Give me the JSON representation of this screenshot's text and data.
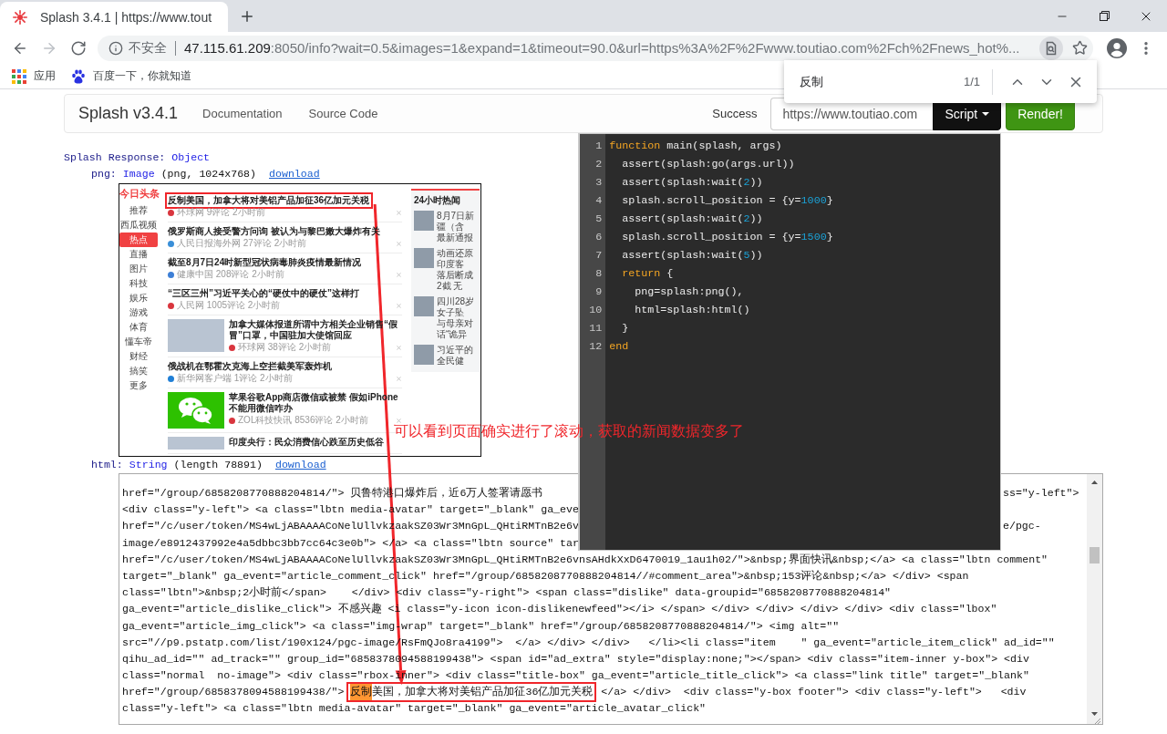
{
  "browser": {
    "tab_title": "Splash 3.4.1 | https://www.tout",
    "nav_buttons": [
      {
        "kind": "back",
        "disabled": false
      },
      {
        "kind": "forward",
        "disabled": true
      },
      {
        "kind": "reload",
        "disabled": false
      }
    ],
    "security_label": "不安全",
    "url_host": "47.115.61.209",
    "url_path": ":8050/info?wait=0.5&images=1&expand=1&timeout=90.0&url=https%3A%2F%2Fwww.toutiao.com%2Fch%2Fnews_hot%...",
    "bookmarks": [
      {
        "kind": "apps",
        "label": "应用"
      },
      {
        "kind": "site",
        "label": "百度一下，你就知道"
      }
    ]
  },
  "find_bar": {
    "query": "反制",
    "count": "1/1"
  },
  "navbar": {
    "brand": "Splash v3.4.1",
    "links": [
      "Documentation",
      "Source Code"
    ],
    "status": "Success",
    "url_field": {
      "value": "https://www.toutiao.com"
    },
    "buttons": [
      {
        "kind": "dropdown",
        "label": "Script",
        "expanded": true
      },
      {
        "kind": "primary",
        "label": "Render!"
      }
    ]
  },
  "script_editor": {
    "lines": [
      {
        "number": "1",
        "tokens": [
          {
            "kind": "keyword",
            "text": "function"
          },
          {
            "kind": "plain",
            "text": " main(splash, args)"
          }
        ]
      },
      {
        "number": "2",
        "tokens": [
          {
            "kind": "plain",
            "text": "  assert(splash:go(args.url))"
          }
        ]
      },
      {
        "number": "3",
        "tokens": [
          {
            "kind": "plain",
            "text": "  assert(splash:wait("
          },
          {
            "kind": "number",
            "text": "2"
          },
          {
            "kind": "plain",
            "text": "))"
          }
        ]
      },
      {
        "number": "4",
        "tokens": [
          {
            "kind": "plain",
            "text": "  splash.scroll_position = {y="
          },
          {
            "kind": "number",
            "text": "1000"
          },
          {
            "kind": "plain",
            "text": "}"
          }
        ]
      },
      {
        "number": "5",
        "tokens": [
          {
            "kind": "plain",
            "text": "  assert(splash:wait("
          },
          {
            "kind": "number",
            "text": "2"
          },
          {
            "kind": "plain",
            "text": "))"
          }
        ]
      },
      {
        "number": "6",
        "tokens": [
          {
            "kind": "plain",
            "text": "  splash.scroll_position = {y="
          },
          {
            "kind": "number",
            "text": "1500"
          },
          {
            "kind": "plain",
            "text": "}"
          }
        ]
      },
      {
        "number": "7",
        "tokens": [
          {
            "kind": "plain",
            "text": "  assert(splash:wait("
          },
          {
            "kind": "number",
            "text": "5"
          },
          {
            "kind": "plain",
            "text": "))"
          }
        ]
      },
      {
        "number": "8",
        "tokens": [
          {
            "kind": "keyword",
            "text": "  return"
          },
          {
            "kind": "plain",
            "text": " {"
          }
        ]
      },
      {
        "number": "9",
        "tokens": [
          {
            "kind": "plain",
            "text": "    png=splash:png(),"
          }
        ]
      },
      {
        "number": "10",
        "tokens": [
          {
            "kind": "plain",
            "text": "    html=splash:html()"
          }
        ]
      },
      {
        "number": "11",
        "tokens": [
          {
            "kind": "plain",
            "text": "  }"
          }
        ]
      },
      {
        "number": "12",
        "tokens": [
          {
            "kind": "keyword",
            "text": "end"
          }
        ]
      }
    ]
  },
  "response": {
    "title": {
      "key": "Splash Response:",
      "type": "Object"
    },
    "fields": [
      {
        "kind": "image",
        "key": "png:",
        "type": "Image",
        "detail": "(png, 1024x768)",
        "link": "download",
        "preview": {
          "logo": "今日头条",
          "nav": [
            {
              "label": "推荐",
              "selected": false
            },
            {
              "label": "西瓜视频",
              "selected": false
            },
            {
              "label": "热点",
              "selected": true
            },
            {
              "label": "直播",
              "selected": false
            },
            {
              "label": "图片",
              "selected": false
            },
            {
              "label": "科技",
              "selected": false
            },
            {
              "label": "娱乐",
              "selected": false
            },
            {
              "label": "游戏",
              "selected": false
            },
            {
              "label": "体育",
              "selected": false
            },
            {
              "label": "懂车帝",
              "selected": false
            },
            {
              "label": "财经",
              "selected": false
            },
            {
              "label": "搞笑",
              "selected": false
            },
            {
              "label": "更多",
              "selected": false
            }
          ],
          "articles": [
            {
              "kind": "text",
              "title": "反制美国，加拿大将对美铝产品加征36亿加元关税",
              "meta": "环球网 9评论 2小时前",
              "color": "#d9363e",
              "boxed": true
            },
            {
              "kind": "text",
              "title": "俄罗斯商人接受警方问询 被认为与黎巴嫩大爆炸有关",
              "meta": "人民日报海外网 27评论 2小时前",
              "color": "#3a8fd8",
              "boxed": false
            },
            {
              "kind": "text",
              "title": "截至8月7日24时新型冠状病毒肺炎疫情最新情况",
              "meta": "健康中国 208评论 2小时前",
              "color": "#3d7fd6",
              "boxed": false
            },
            {
              "kind": "text",
              "title": "“三区三州”习近平关心的“硬仗中的硬仗”这样打",
              "meta": "人民网 1005评论 2小时前",
              "color": "#d9363e",
              "boxed": false
            },
            {
              "kind": "photo",
              "title": "加拿大媒体报道所谓中方相关企业销售“假冒”口罩，中国驻加大使馆回应",
              "meta": "环球网 38评论 2小时前",
              "color": "#d9363e",
              "boxed": false
            },
            {
              "kind": "text",
              "title": "俄战机在鄂霍次克海上空拦截美军轰炸机",
              "meta": "新华网客户端 1评论 2小时前",
              "color": "#1f7fd6",
              "boxed": false
            },
            {
              "kind": "logo",
              "title": "苹果谷歌App商店微信或被禁 假如iPhone不能用微信咋办",
              "meta": "ZOL科技快讯 8536评论 2小时前",
              "color": "#d9363e",
              "boxed": false
            },
            {
              "kind": "photo",
              "title": "印度央行：民众消费信心跌至历史低谷",
              "boxed": false
            }
          ],
          "hot_news": {
            "title": "24小时热闻",
            "items": [
              {
                "lines": [
                  "8月7日新疆（含",
                  "最新通报"
                ]
              },
              {
                "lines": [
                  "动画还原印度客",
                  "落后断成2截 无"
                ]
              },
              {
                "lines": [
                  "四川28岁女子坠",
                  "与母亲对话“诡异"
                ]
              },
              {
                "lines": [
                  "习近平的全民健"
                ]
              }
            ]
          }
        }
      },
      {
        "kind": "text",
        "key": "html:",
        "type": "String",
        "detail": "(length 78891)",
        "link": "download",
        "source": {
          "lines": [
            {
              "segments": [
                {
                  "kind": "plain",
                  "text": "href=\"/group/6858208770888204814/\"> 贝鲁特港口爆炸后，近6万人签署请愿书"
                },
                {
                  "kind": "after_overlay",
                  "text": "ss=\"y-left\">"
                }
              ]
            },
            {
              "segments": [
                {
                  "kind": "plain",
                  "text": "<div class=\"y-left\"> <a class=\"lbtn media-avatar\" target=\"_blank\" ga_eve"
                }
              ]
            },
            {
              "segments": [
                {
                  "kind": "plain",
                  "text": "href=\"/c/user/token/MS4wLjABAAAACoNelUllvkzaakSZ03Wr3MnGpL_QHtiRMTnB2e6v"
                },
                {
                  "kind": "after_overlay",
                  "text": "e/pgc-"
                }
              ]
            },
            {
              "segments": [
                {
                  "kind": "plain",
                  "text": "image/e8912437992e4a5dbbc3bb7cc64c3e0b\"> </a> <a class=\"lbtn source\" tar"
                }
              ]
            },
            {
              "segments": [
                {
                  "kind": "plain",
                  "text": "href=\"/c/user/token/MS4wLjABAAAACoNelUllvkzaakSZ03Wr3MnGpL_QHtiRMTnB2e6vnsAHdkXxD6470019_1au1h02/\">&nbsp;界面快讯&nbsp;</a> <a class=\"lbtn comment\""
                }
              ]
            },
            {
              "segments": [
                {
                  "kind": "plain",
                  "text": "target=\"_blank\" ga_event=\"article_comment_click\" href=\"/group/6858208770888204814//#comment_area\">&nbsp;153评论&nbsp;</a> </div> <span"
                }
              ]
            },
            {
              "segments": [
                {
                  "kind": "plain",
                  "text": "class=\"lbtn\">&nbsp;2小时前</span>    </div> <div class=\"y-right\"> <span class=\"dislike\" data-groupid=\"6858208770888204814\""
                }
              ]
            },
            {
              "segments": [
                {
                  "kind": "plain",
                  "text": "ga_event=\"article_dislike_click\"> 不感兴趣 <i class=\"y-icon icon-dislikenewfeed\"></i> </span> </div> </div> </div> </div> <div class=\"lbox\""
                }
              ]
            },
            {
              "segments": [
                {
                  "kind": "plain",
                  "text": "ga_event=\"article_img_click\"> <a class=\"img-wrap\" target=\"_blank\" href=\"/group/6858208770888204814/\"> <img alt=\"\""
                }
              ]
            },
            {
              "segments": [
                {
                  "kind": "plain",
                  "text": "src=\"//p9.pstatp.com/list/190x124/pgc-image/RsFmQJo8ra4199\">  </a> </div> </div>   </li><li class=\"item    \" ga_event=\"article_item_click\" ad_id=\"\""
                }
              ]
            },
            {
              "segments": [
                {
                  "kind": "plain",
                  "text": "qihu_ad_id=\"\" ad_track=\"\" group_id=\"6858378094588199438\"> <span id=\"ad_extra\" style=\"display:none;\"></span> <div class=\"item-inner y-box\"> <div"
                }
              ]
            },
            {
              "segments": [
                {
                  "kind": "plain",
                  "text": "class=\"normal  no-image\"> <div class=\"rbox-inner\"> <div class=\"title-box\" ga_event=\"article_title_click\"> <a class=\"link title\" target=\"_blank\""
                }
              ]
            },
            {
              "segments": [
                {
                  "kind": "plain",
                  "text": "href=\"/group/6858378094588199438/\"> "
                },
                {
                  "kind": "boxed",
                  "parts": [
                    {
                      "kind": "match",
                      "text": "反制"
                    },
                    {
                      "kind": "plain",
                      "text": "美国，加拿大将对美铝产品加征36亿加元关税"
                    }
                  ]
                },
                {
                  "kind": "plain",
                  "text": " </a> </div>  <div class=\"y-box footer\"> <div class=\"y-left\">   <div"
                }
              ]
            },
            {
              "segments": [
                {
                  "kind": "plain",
                  "text": "class=\"y-left\"> <a class=\"lbtn media-avatar\" target=\"_blank\" ga_event=\"article_avatar_click\""
                }
              ]
            }
          ]
        }
      }
    ]
  },
  "annotation": {
    "text": "可以看到页面确实进行了滚动，获取的新闻数据变多了"
  }
}
